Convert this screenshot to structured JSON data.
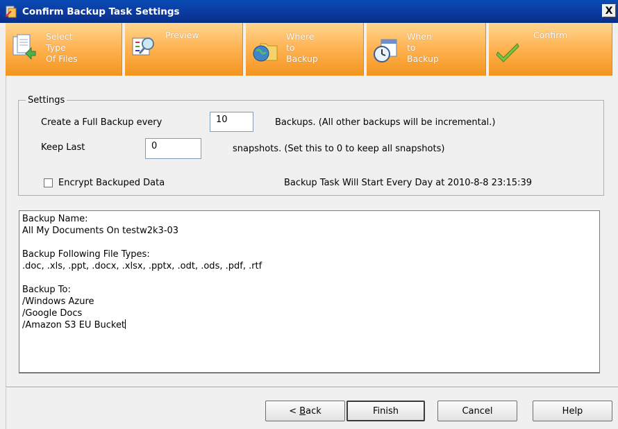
{
  "window": {
    "title": "Confirm Backup Task Settings",
    "close_glyph": "X",
    "title_icon": "app-icon"
  },
  "steps": [
    {
      "label": "Select\nType\nOf Files",
      "icon": "files-icon"
    },
    {
      "label": "Preview",
      "icon": "preview-magnifier-icon"
    },
    {
      "label": "Where\nto\nBackup",
      "icon": "globe-folder-icon"
    },
    {
      "label": "When\nto\nBackup",
      "icon": "calendar-clock-icon"
    },
    {
      "label": "Confirm",
      "icon": "checkmark-icon"
    }
  ],
  "settings": {
    "legend": "Settings",
    "full_backup_label": "Create a Full Backup every",
    "full_backup_value": "10",
    "full_backup_suffix": "Backups. (All other backups will be incremental.)",
    "keep_last_label": "Keep Last",
    "keep_last_value": "0",
    "keep_last_suffix": "snapshots. (Set this to 0 to keep all snapshots)",
    "encrypt_label": "Encrypt Backuped Data",
    "encrypt_checked": false,
    "schedule_text": "Backup Task Will Start Every Day at 2010-8-8 23:15:39"
  },
  "summary": {
    "lines": [
      "Backup Name:",
      "All My Documents On testw2k3-03",
      "",
      "Backup Following File Types:",
      ".doc, .xls, .ppt, .docx, .xlsx, .pptx, .odt, .ods, .pdf, .rtf",
      "",
      "Backup To:",
      "/Windows Azure",
      "/Google Docs",
      "/Amazon S3 EU Bucket"
    ]
  },
  "buttons": {
    "back_prefix": "< ",
    "back_mnemonic": "B",
    "back_rest": "ack",
    "finish": "Finish",
    "cancel": "Cancel",
    "help": "Help"
  }
}
